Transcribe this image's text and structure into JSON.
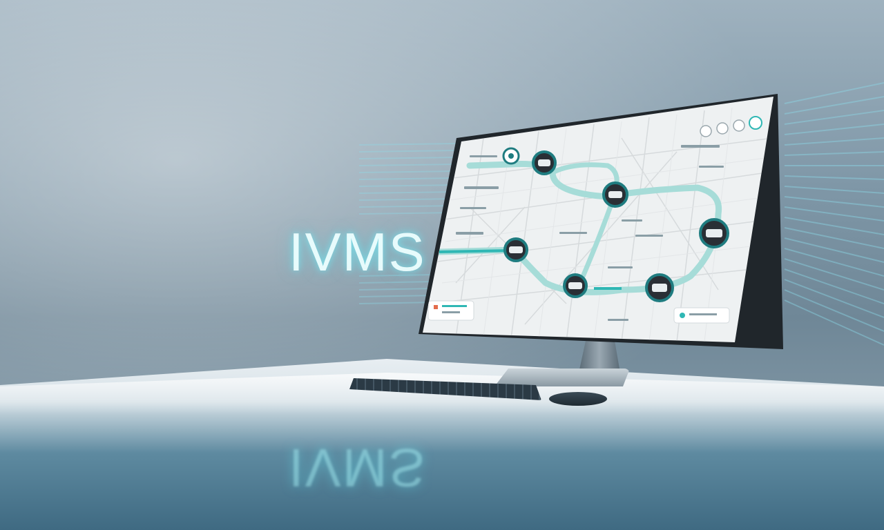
{
  "logo": {
    "text": "IVMS"
  },
  "colors": {
    "accent": "#2fb7b4",
    "route": "#a6dcd8",
    "vehicle_ring": "#1f7c80",
    "vehicle_fill": "#2a2f35",
    "screen_bg": "#eef1f2"
  },
  "map": {
    "route_color": "#a6dcd8",
    "vehicles": [
      {
        "icon": "car-icon"
      },
      {
        "icon": "car-icon"
      },
      {
        "icon": "car-icon"
      },
      {
        "icon": "car-icon"
      },
      {
        "icon": "car-icon"
      },
      {
        "icon": "car-icon"
      }
    ],
    "toolbar_icons": [
      "globe-icon",
      "close-icon",
      "user-icon",
      "settings-icon"
    ]
  }
}
